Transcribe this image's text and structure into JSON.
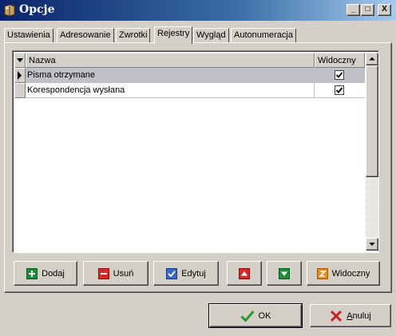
{
  "window": {
    "title": "Opcje",
    "controls": {
      "minimize": "_",
      "maximize": "□",
      "close": "X"
    }
  },
  "tabs": [
    {
      "label": "Ustawienia",
      "active": false
    },
    {
      "label": "Adresowanie",
      "active": false
    },
    {
      "label": "Zwrotki",
      "active": false
    },
    {
      "label": "Rejestry",
      "active": true
    },
    {
      "label": "Wygląd",
      "active": false
    },
    {
      "label": "Autonumeracja",
      "active": false
    }
  ],
  "grid": {
    "columns": {
      "name": "Nazwa",
      "visible": "Widoczny"
    },
    "rows": [
      {
        "name": "Pisma otrzymane",
        "visible": true,
        "selected": true
      },
      {
        "name": "Korespondencja wysłana",
        "visible": true,
        "selected": false
      }
    ]
  },
  "actions": {
    "add": "Dodaj",
    "delete": "Usuń",
    "edit": "Edytuj",
    "visible": "Widoczny"
  },
  "dialog": {
    "ok": "OK",
    "cancel_first": "A",
    "cancel_rest": "nuluj"
  },
  "icons": {
    "app": "book-icon",
    "add": "plus-icon",
    "delete": "minus-icon",
    "edit": "check-icon",
    "move_up": "arrow-up-icon",
    "move_down": "arrow-down-icon",
    "visible": "toggle-icon",
    "ok": "check-icon",
    "cancel": "x-icon"
  },
  "colors": {
    "title_start": "#0a246a",
    "title_end": "#a6caf0",
    "face": "#d4d0c8",
    "green": "#1e8c3a",
    "red": "#d22b2b",
    "orange": "#e88a1a",
    "blue": "#3a6ac0"
  }
}
